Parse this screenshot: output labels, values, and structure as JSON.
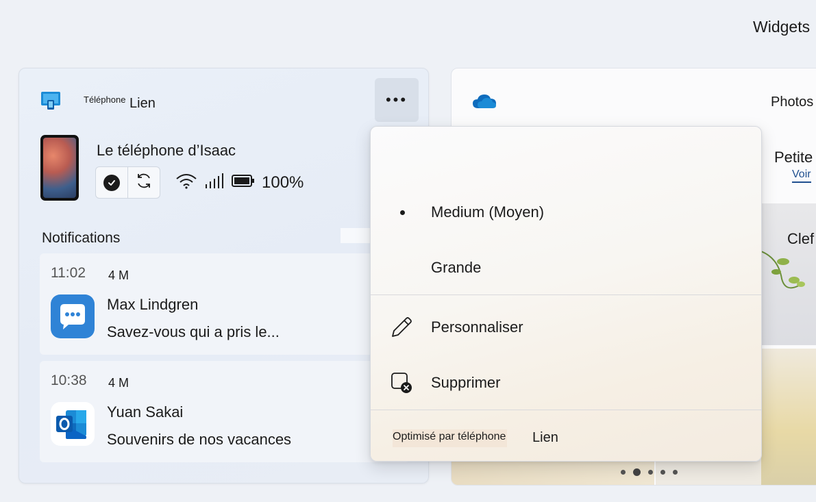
{
  "board": {
    "title": "Widgets"
  },
  "phone_widget": {
    "title_small": "Téléphone",
    "title_big": "Lien",
    "more_label": "•••",
    "device_name": "Le téléphone d’Isaac",
    "battery": "100%",
    "notifications_header": "Notifications",
    "notifications": [
      {
        "time": "11:02",
        "age": "4 M",
        "sender": "Max Lindgren",
        "body": "Savez-vous qui a pris le...",
        "app_icon": "messages-icon"
      },
      {
        "time": "10:38",
        "age": "4 M",
        "sender": "Yuan Sakai",
        "body": "Souvenirs de nos vacances",
        "app_icon": "outlook-icon"
      }
    ],
    "icons": [
      "phone-link-app-icon",
      "check-icon",
      "sync-icon",
      "wifi-icon",
      "signal-icon",
      "battery-icon"
    ]
  },
  "photos_widget": {
    "title": "Photos",
    "subtitle": "Petite",
    "link": "Voir",
    "tile_caption": "Clef",
    "icons": [
      "onedrive-icon"
    ],
    "carousel_dots": 5,
    "carousel_active_index": 1
  },
  "menu": {
    "items": [
      {
        "label": "Medium (Moyen)",
        "selected": true
      },
      {
        "label": "Grande",
        "selected": false
      },
      {
        "label": "Personnaliser",
        "icon": "pencil-icon"
      },
      {
        "label": "Supprimer",
        "icon": "remove-widget-icon"
      }
    ],
    "footer_powered": "Optimisé par téléphone",
    "footer_link": "Lien"
  },
  "colors": {
    "accent_blue": "#0f6cbd",
    "link_blue": "#1f4f8f",
    "outlook_blue": "#0a64c4",
    "messages_blue": "#2f83d6"
  }
}
